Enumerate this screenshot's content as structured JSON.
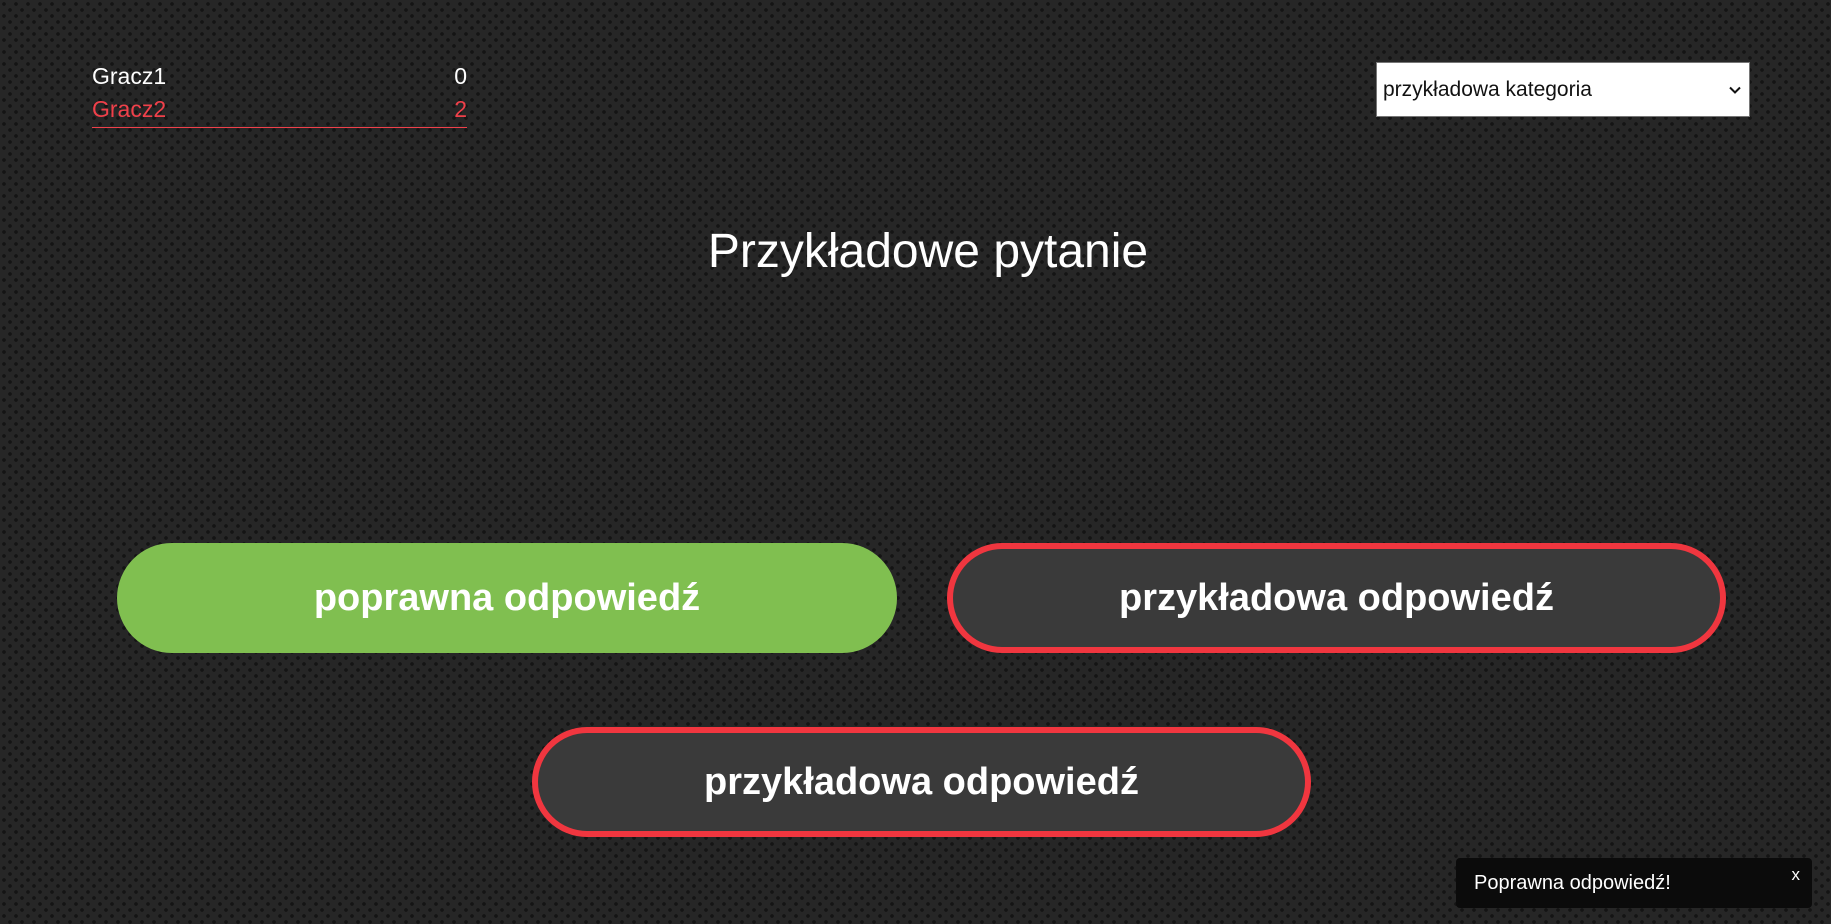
{
  "scoreboard": {
    "players": [
      {
        "name": "Gracz1",
        "score": "0",
        "color": "#ffffff"
      },
      {
        "name": "Gracz2",
        "score": "2",
        "color": "#f0404a"
      }
    ]
  },
  "category_select": {
    "selected": "przykładowa kategoria",
    "icon": "chevron-down-icon"
  },
  "question": {
    "text": "Przykładowe pytanie"
  },
  "answers": [
    {
      "label": "poprawna odpowiedź",
      "state": "correct",
      "color": "#80bf50"
    },
    {
      "label": "przykładowa odpowiedź",
      "state": "wrong",
      "color": "#f0363f"
    },
    {
      "label": "przykładowa odpowiedź",
      "state": "wrong",
      "color": "#f0363f"
    }
  ],
  "toast": {
    "message": "Poprawna odpowiedź!",
    "close_label": "x"
  },
  "colors": {
    "background": "#262626",
    "correct": "#80bf50",
    "wrong_border": "#f0363f",
    "active_player": "#f0404a"
  }
}
